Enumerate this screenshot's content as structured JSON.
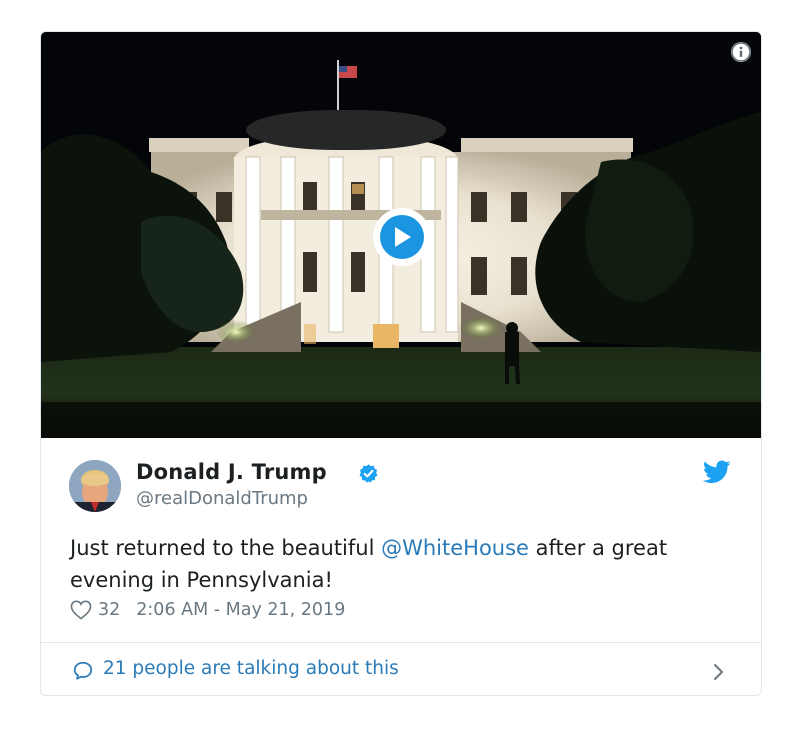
{
  "tweet": {
    "author_name": "Donald J. Trump",
    "author_handle": "@realDonaldTrump",
    "text_before": "Just returned to the beautiful ",
    "mention": "@WhiteHouse",
    "text_after": " after a great evening in Pennsylvania!",
    "likes": "32",
    "timestamp": "2:06 AM - May 21, 2019"
  },
  "footer": {
    "talking": "21 people are talking about this"
  },
  "icons": {
    "info": "info-icon",
    "play": "play-icon",
    "verified": "verified-badge-icon",
    "brand": "twitter-bird-icon",
    "like": "heart-icon",
    "reply": "speech-bubble-icon",
    "more": "chevron-right-icon"
  },
  "colors": {
    "accent": "#1da1f2",
    "link": "#2b7bb9",
    "muted": "#697882",
    "text": "#1c2022"
  }
}
